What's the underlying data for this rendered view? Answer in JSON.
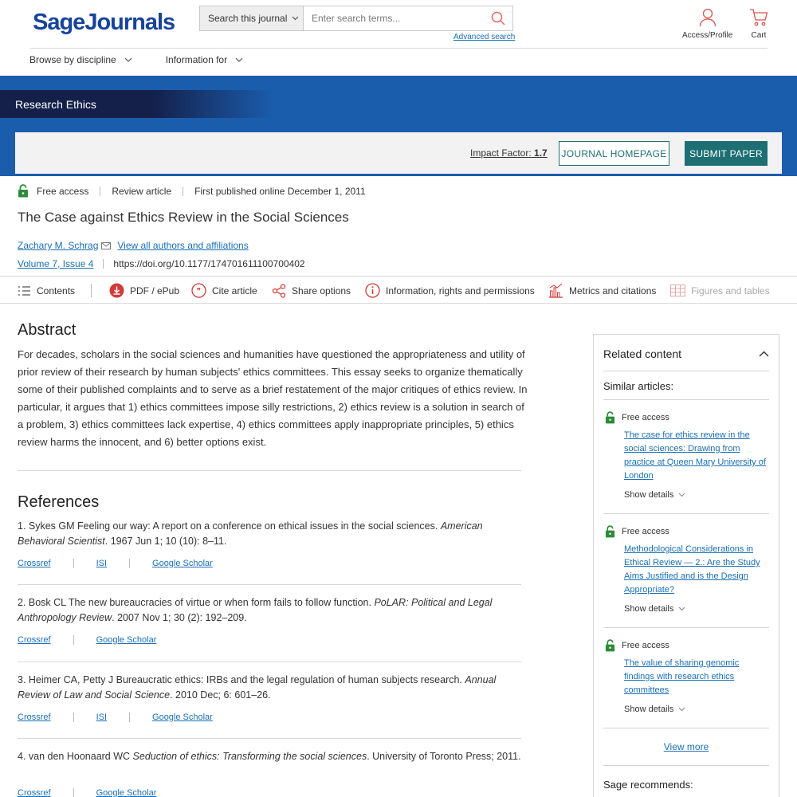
{
  "header": {
    "logo": "SageJournals",
    "search_scope": "Search this journal",
    "search_placeholder": "Enter search terms...",
    "advanced_search": "Advanced search",
    "profile_label": "Access/Profile",
    "cart_label": "Cart",
    "nav": [
      "Browse by discipline",
      "Information for"
    ]
  },
  "journal": {
    "name": "Research Ethics",
    "impact_label": "Impact Factor:",
    "impact_value": "1.7",
    "homepage_btn": "JOURNAL HOMEPAGE",
    "submit_btn": "SUBMIT PAPER"
  },
  "article": {
    "access": "Free access",
    "type": "Review article",
    "published": "First published online December 1, 2011",
    "title": "The Case against Ethics Review in the Social Sciences",
    "author": "Zachary M. Schrag",
    "all_authors": "View all authors and affiliations",
    "volume": "Volume 7, Issue 4",
    "doi": "https://doi.org/10.1177/174701611100700402"
  },
  "toolbar": {
    "contents": "Contents",
    "pdf": "PDF / ePub",
    "cite": "Cite article",
    "share": "Share options",
    "info": "Information, rights and permissions",
    "metrics": "Metrics and citations",
    "figures": "Figures and tables"
  },
  "abstract": {
    "heading": "Abstract",
    "text": "For decades, scholars in the social sciences and humanities have questioned the appropriateness and utility of prior review of their research by human subjects' ethics committees. This essay seeks to organize thematically some of their published complaints and to serve as a brief restatement of the major critiques of ethics review. In particular, it argues that 1) ethics committees impose silly restrictions, 2) ethics review is a solution in search of a problem, 3) ethics committees lack expertise, 4) ethics committees apply inappropriate principles, 5) ethics review harms the innocent, and 6) better options exist."
  },
  "references": {
    "heading": "References",
    "items": [
      {
        "pre": "1. Sykes GM Feeling our way: A report on a conference on ethical issues in the social sciences. ",
        "ital": "American Behavioral Scientist",
        "post": ". 1967 Jun 1; 10 (10): 8–11.",
        "links": [
          "Crossref",
          "ISI",
          "Google Scholar"
        ]
      },
      {
        "pre": "2. Bosk CL The new bureaucracies of virtue or when form fails to follow function. ",
        "ital": "PoLAR: Political and Legal Anthropology Review",
        "post": ". 2007 Nov 1; 30 (2): 192–209.",
        "links": [
          "Crossref",
          "Google Scholar"
        ]
      },
      {
        "pre": "3. Heimer CA, Petty J Bureaucratic ethics: IRBs and the legal regulation of human subjects research. ",
        "ital": "Annual Review of Law and Social Science",
        "post": ". 2010 Dec; 6: 601–26.",
        "links": [
          "Crossref",
          "ISI",
          "Google Scholar"
        ]
      },
      {
        "pre": "4. van den Hoonaard WC ",
        "ital": "Seduction of ethics: Transforming the social sciences",
        "post": ". University of Toronto Press; 2011.",
        "links": [
          "Crossref",
          "Google Scholar"
        ]
      }
    ]
  },
  "sidebar": {
    "heading": "Related content",
    "similar": "Similar articles:",
    "items": [
      {
        "access": "Free access",
        "title": "The case for ethics review in the social sciences: Drawing from practice at Queen Mary University of London",
        "details": "Show details"
      },
      {
        "access": "Free access",
        "title": "Methodological Considerations in Ethical Review — 2.: Are the Study Aims Justified and is the Design Appropriate?",
        "details": "Show details"
      },
      {
        "access": "Free access",
        "title": "The value of sharing genomic findings with research ethics committees",
        "details": "Show details"
      }
    ],
    "view_more": "View more",
    "recommends": "Sage recommends:"
  },
  "colors": {
    "brand_blue": "#17449a",
    "banner_blue": "#1b5dad",
    "teal": "#1d6f73",
    "link": "#1a6fb5",
    "access_green": "#2e8b3a",
    "icon_red": "#d23a3a"
  }
}
